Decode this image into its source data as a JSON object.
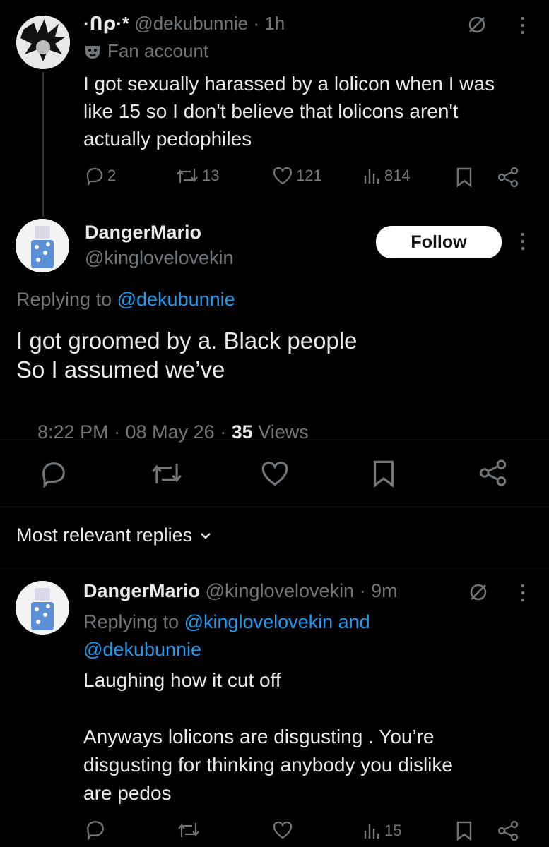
{
  "tweet1": {
    "display_name": "·Ո⍴·*",
    "handle": "@dekubunnie",
    "time": "· 1h",
    "label": "Fan account",
    "text_lines": [
      "I got sexually harassed by a lolicon when I was",
      "like 15 so I don't believe that lolicons aren't",
      "actually pedophiles"
    ],
    "stats": {
      "replies": "2",
      "reposts": "13",
      "likes": "121",
      "views": "814"
    }
  },
  "main_tweet": {
    "display_name": "DangerMario",
    "handle": "@kinglovelovekin",
    "follow_label": "Follow",
    "replying_prefix": "Replying to",
    "replying_to": "@dekubunnie",
    "text_lines": [
      "I got groomed by a. Black people",
      "So I assumed we’ve"
    ],
    "meta_time": "8:22 PM · 08 May 26 · ",
    "meta_views_count": "35",
    "meta_views_label": " Views"
  },
  "sort": {
    "label": "Most relevant replies"
  },
  "reply": {
    "display_name": "DangerMario",
    "handle": "@kinglovelovekin",
    "time": "· 9m",
    "replying_prefix": "Replying to",
    "replying_to_line1": "@kinglovelovekin and",
    "replying_to_line2": "@dekubunnie",
    "text_line1": "Laughing how it cut off",
    "text_lines2": [
      "Anyways lolicons are disgusting . You’re",
      "disgusting for thinking anybody you dislike",
      "are pedos"
    ],
    "stats": {
      "views": "15"
    }
  },
  "colors": {
    "background": "#000000",
    "text": "#e7e9ea",
    "secondary": "#71767b",
    "link": "#1d9bf0",
    "divider": "#2f3336"
  }
}
